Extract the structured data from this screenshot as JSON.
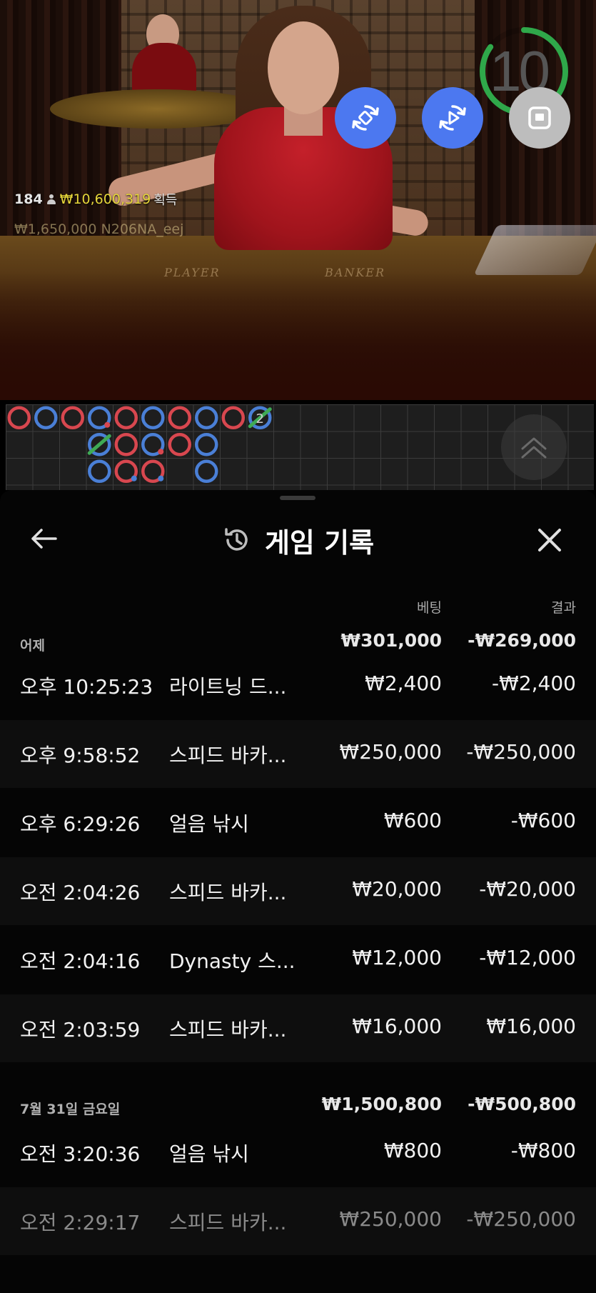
{
  "live": {
    "player_count": "184",
    "winnings": "₩10,600,319",
    "winnings_suffix": "획득",
    "ticker": "₩1,650,000  N206NA_eej",
    "player_label": "PLAYER",
    "banker_label": "BANKER",
    "timer": "10",
    "timer_progress": 0.85
  },
  "controls": [
    {
      "name": "rebet-button",
      "icon": "rotate-arrows-icon"
    },
    {
      "name": "autoplay-button",
      "icon": "replay-play-icon"
    },
    {
      "name": "stop-button",
      "icon": "stop-square-icon"
    }
  ],
  "roadmap": {
    "red": "#d8474f",
    "blue": "#4a7fd6",
    "green": "#3faa55",
    "tie_count": "2"
  },
  "sheet": {
    "title": "게임 기록",
    "back_icon": "arrow-left-icon",
    "history_icon": "history-clock-icon",
    "close_icon": "close-x-icon",
    "col_bet": "베팅",
    "col_result": "결과",
    "groups": [
      {
        "label": "어제",
        "bet_total": "₩301,000",
        "result_total": "-₩269,000",
        "rows": [
          {
            "time": "오후 10:25:23",
            "game": "라이트닝 드...",
            "bet": "₩2,400",
            "result": "-₩2,400"
          },
          {
            "time": "오후 9:58:52",
            "game": "스피드 바카...",
            "bet": "₩250,000",
            "result": "-₩250,000"
          },
          {
            "time": "오후 6:29:26",
            "game": "얼음 낚시",
            "bet": "₩600",
            "result": "-₩600"
          },
          {
            "time": "오전 2:04:26",
            "game": "스피드 바카...",
            "bet": "₩20,000",
            "result": "-₩20,000"
          },
          {
            "time": "오전 2:04:16",
            "game": "Dynasty 스...",
            "bet": "₩12,000",
            "result": "-₩12,000"
          },
          {
            "time": "오전 2:03:59",
            "game": "스피드 바카...",
            "bet": "₩16,000",
            "result": "₩16,000"
          }
        ]
      },
      {
        "label": "7월 31일 금요일",
        "bet_total": "₩1,500,800",
        "result_total": "-₩500,800",
        "rows": [
          {
            "time": "오전 3:20:36",
            "game": "얼음 낚시",
            "bet": "₩800",
            "result": "-₩800"
          },
          {
            "time": "오전 2:29:17",
            "game": "스피드 바카...",
            "bet": "₩250,000",
            "result": "-₩250,000"
          }
        ]
      }
    ]
  }
}
